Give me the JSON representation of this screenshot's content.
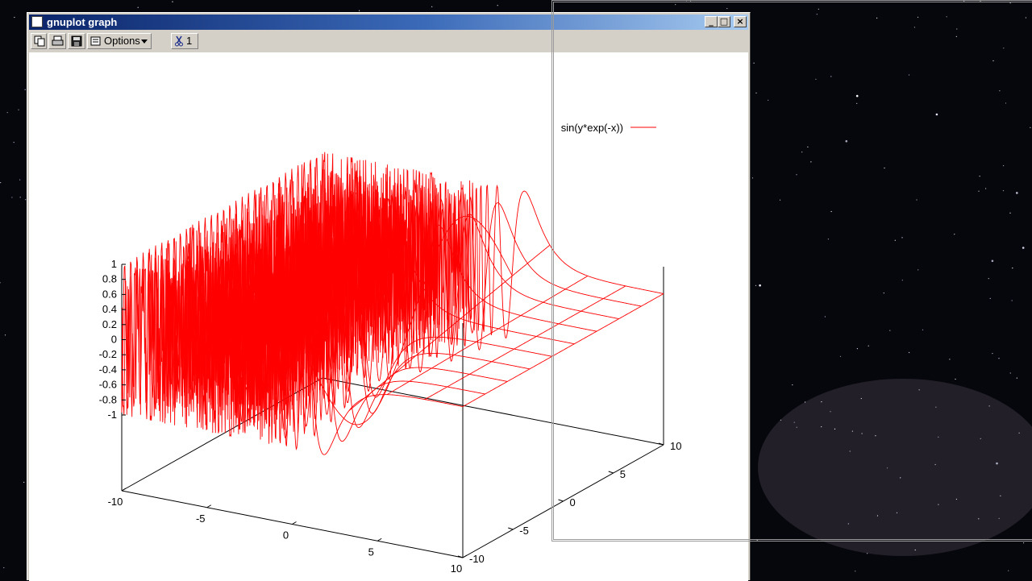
{
  "window": {
    "title": "gnuplot graph",
    "controls": {
      "minimize": "_",
      "maximize": "□",
      "close": "×"
    }
  },
  "toolbar": {
    "copy_icon": "copy-icon",
    "print_icon": "print-icon",
    "save_icon": "save-icon",
    "options_label": "Options",
    "options_icon": "options-icon",
    "dropdown_icon": "chevron-down-icon",
    "replot_icon": "scissors-icon",
    "replot_label": "1"
  },
  "colors": {
    "curve": "#ff0000",
    "titlebar_start": "#0a246a",
    "titlebar_end": "#a6caf0"
  },
  "chart_data": {
    "type": "surface",
    "function": "sin(y*exp(-x))",
    "legend": [
      {
        "name": "sin(y*exp(-x))",
        "color": "#ff0000"
      }
    ],
    "legend_position": "top-right",
    "grid": false,
    "x_range": [
      -10,
      10
    ],
    "y_range": [
      -10,
      10
    ],
    "z_range": [
      -1,
      1
    ],
    "isosamples": 10,
    "z_ticks": [
      "1",
      "0.8",
      "0.6",
      "0.4",
      "0.2",
      "0",
      "-0.2",
      "-0.4",
      "-0.6",
      "-0.8",
      "-1"
    ],
    "x_ticks": [
      "-10",
      "-5",
      "0",
      "5",
      "10"
    ],
    "y_ticks": [
      "-10",
      "-5",
      "0",
      "5",
      "10"
    ]
  }
}
